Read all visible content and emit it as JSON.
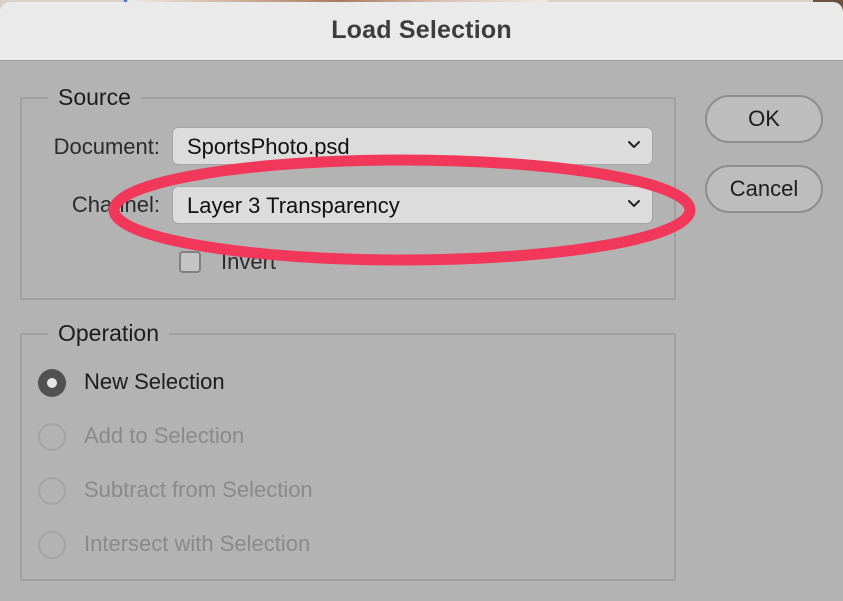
{
  "window": {
    "title": "Load Selection"
  },
  "source": {
    "legend": "Source",
    "document_label": "Document:",
    "document_value": "SportsPhoto.psd",
    "channel_label": "Channel:",
    "channel_value": "Layer 3 Transparency",
    "invert_label": "Invert",
    "invert_checked": false
  },
  "operation": {
    "legend": "Operation",
    "options": [
      {
        "label": "New Selection",
        "selected": true,
        "enabled": true
      },
      {
        "label": "Add to Selection",
        "selected": false,
        "enabled": false
      },
      {
        "label": "Subtract from Selection",
        "selected": false,
        "enabled": false
      },
      {
        "label": "Intersect with Selection",
        "selected": false,
        "enabled": false
      }
    ]
  },
  "buttons": {
    "ok": "OK",
    "cancel": "Cancel"
  },
  "annotation": {
    "shape": "ellipse",
    "color": "#f2385a",
    "target": "channel"
  },
  "colors": {
    "dialog_bg": "#b3b3b3",
    "titlebar_bg": "#eaeaea"
  },
  "icons": {
    "select_arrow": "chevron-down-icon"
  }
}
